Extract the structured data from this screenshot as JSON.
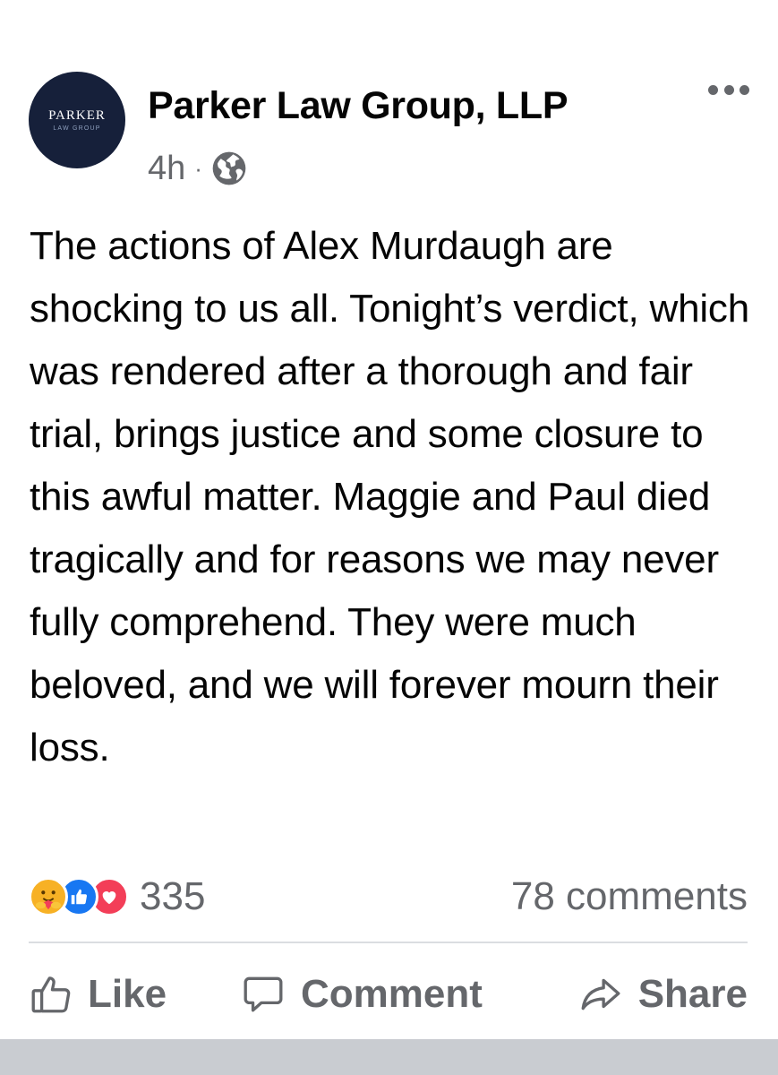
{
  "post": {
    "author": {
      "name": "Parker Law Group, LLP",
      "avatar_line1": "PARKER",
      "avatar_line2": "LAW GROUP"
    },
    "timestamp": "4h",
    "separator": "·",
    "audience_icon": "globe-icon",
    "more_icon": "more-options-icon",
    "text": "The actions of Alex Murdaugh are shocking to us all. Tonight’s verdict, which was rendered after a thorough and fair trial, brings justice and some closure to this awful matter. Maggie and Paul died tragically and for reasons we may never fully comprehend. They were much beloved, and we will forever mourn their loss.",
    "reactions": {
      "icons": [
        "care",
        "like",
        "love"
      ],
      "count": "335"
    },
    "comments_count": "78 comments",
    "actions": {
      "like": "Like",
      "comment": "Comment",
      "share": "Share"
    }
  },
  "colors": {
    "primary_text": "#050505",
    "secondary_text": "#65676b",
    "like_blue": "#1877f2",
    "love_red": "#f33e58",
    "care_yellow": "#f7b125",
    "avatar_bg": "#16203a"
  }
}
